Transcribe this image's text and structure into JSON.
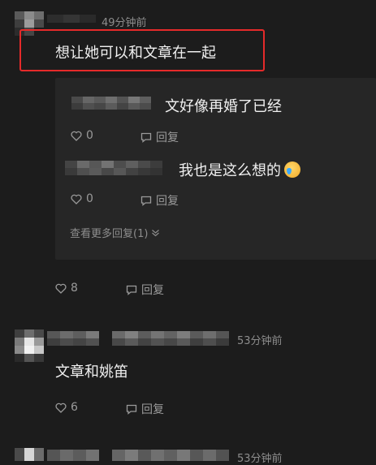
{
  "comment1": {
    "time": "49分钟前",
    "text": "想让她可以和文章在一起",
    "likes": "8",
    "reply_label": "回复"
  },
  "replies": [
    {
      "text": "文好像再婚了已经",
      "likes": "0",
      "reply_label": "回复"
    },
    {
      "text": "我也是这么想的",
      "emoji": "crying-laughing-emoji",
      "likes": "0",
      "reply_label": "回复"
    }
  ],
  "more_replies_label": "查看更多回复(1)",
  "comment2": {
    "time": "53分钟前",
    "text": "文章和姚笛",
    "likes": "6",
    "reply_label": "回复"
  },
  "comment3": {
    "time": "53分钟前"
  },
  "colors": {
    "background": "#1c1c1c",
    "panel": "#262626",
    "highlight": "#e52a2a",
    "muted_text": "#8d8d8d"
  }
}
